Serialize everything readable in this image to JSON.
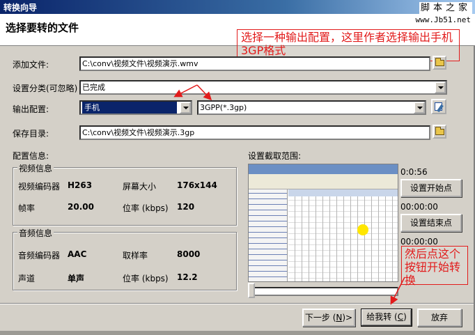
{
  "window": {
    "title": "转换向导"
  },
  "watermark": {
    "name": "脚本之家",
    "url": "www.Jb51.net"
  },
  "header": {
    "title": "选择要转的文件"
  },
  "form": {
    "add_file_label": "添加文件:",
    "add_file_value": "C:\\conv\\视频文件\\视频演示.wmv",
    "category_label": "设置分类(可忽略)",
    "category_value": "已完成",
    "output_label": "输出配置:",
    "output_device": "手机",
    "output_format": "3GPP(*.3gp)",
    "save_label": "保存目录:",
    "save_value": "C:\\conv\\视频文件\\视频演示.3gp"
  },
  "config": {
    "title": "配置信息:",
    "video": {
      "title": "视频信息",
      "codec_label": "视频编码器",
      "codec_value": "H263",
      "size_label": "屏幕大小",
      "size_value": "176x144",
      "fps_label": "帧率",
      "fps_value": "20.00",
      "bitrate_label": "位率 (kbps)",
      "bitrate_value": "120"
    },
    "audio": {
      "title": "音频信息",
      "codec_label": "音频编码器",
      "codec_value": "AAC",
      "rate_label": "取样率",
      "rate_value": "8000",
      "channel_label": "声道",
      "channel_value": "单声",
      "bitrate_label": "位率 (kbps)",
      "bitrate_value": "12.2"
    }
  },
  "range": {
    "title": "设置截取范围:",
    "duration": "0:0:56",
    "start_button": "设置开始点",
    "start_time": "00:00:00",
    "end_button": "设置结束点",
    "end_time": "00:00:00",
    "position": 0
  },
  "buttons": {
    "next_label": "下一步 (",
    "next_key": "N",
    "next_suffix": ")>",
    "convert_label": "给我转 (",
    "convert_key": "C",
    "convert_suffix": ")",
    "cancel_label": "放弃"
  },
  "annotations": {
    "callout_top": "选择一种输出配置，这里作者选择输出手机3GP格式",
    "callout_bottom": "然后点这个按钮开始转换",
    "color": "#e21b1b"
  }
}
